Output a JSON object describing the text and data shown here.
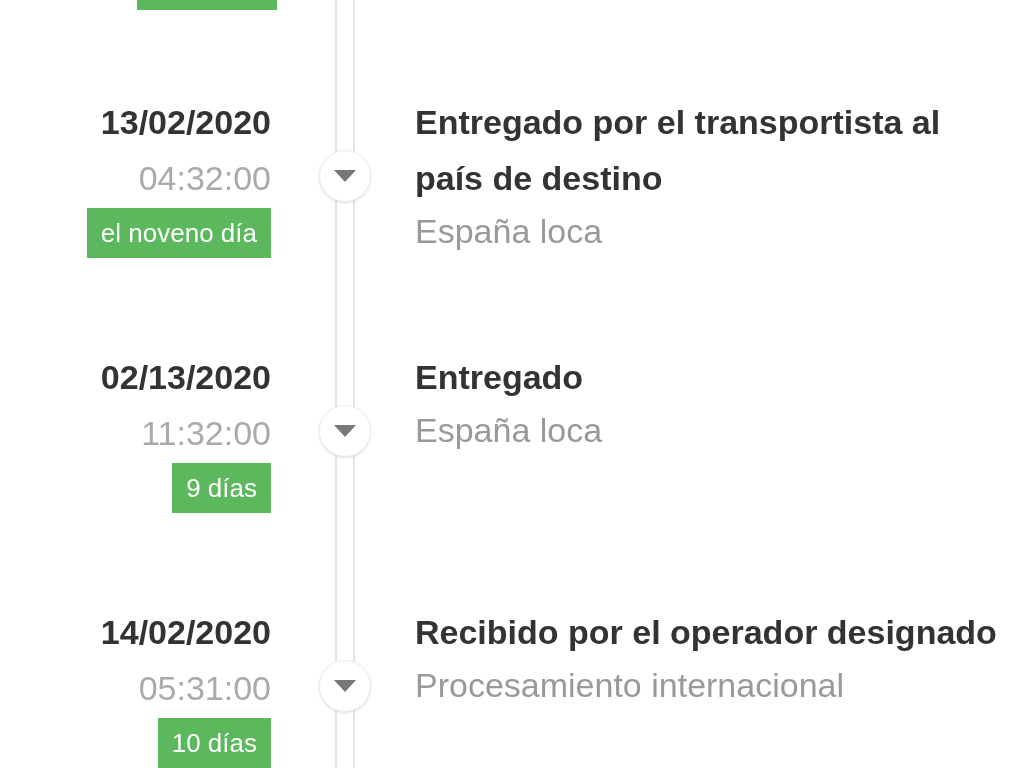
{
  "events": [
    {
      "date": "13/02/2020",
      "time": "04:32:00",
      "tag": "el noveno día",
      "title": "Entregado por el transportista al país de destino",
      "location": "España loca"
    },
    {
      "date": "02/13/2020",
      "time": "11:32:00",
      "tag": "9 días",
      "title": "Entregado",
      "location": "España loca"
    },
    {
      "date": "14/02/2020",
      "time": "05:31:00",
      "tag": "10 días",
      "title": "Recibido por el operador designado",
      "location": "Procesamiento internacional"
    }
  ]
}
